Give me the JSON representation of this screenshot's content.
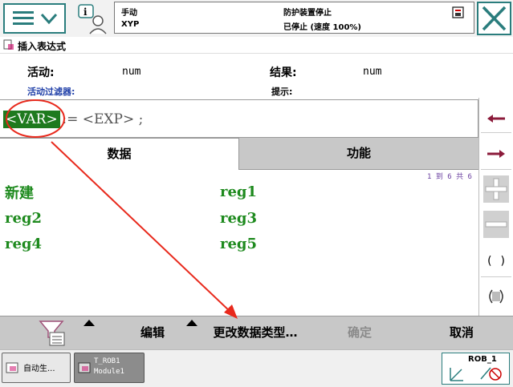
{
  "status": {
    "mode": "手动",
    "controller": "XYP",
    "protection": "防护装置停止",
    "speed": "已停止 (速度 100%)"
  },
  "window_title": "插入表达式",
  "info": {
    "active_label": "活动:",
    "active_value": "num",
    "result_label": "结果:",
    "result_value": "num",
    "filter_label": "活动过滤器:",
    "hint_label": "提示:"
  },
  "expression": {
    "selected_token": "<VAR>",
    "rest": " := <EXP> ;"
  },
  "tabs": {
    "data": "数据",
    "function": "功能"
  },
  "list_count": "1 到 6 共 6",
  "items": [
    "新建",
    "reg1",
    "reg2",
    "reg3",
    "reg4",
    "reg5"
  ],
  "right_buttons": {
    "parens": "( )"
  },
  "toolbar": {
    "edit": "编辑",
    "change_type": "更改数据类型…",
    "ok": "确定",
    "cancel": "取消"
  },
  "taskbar": {
    "task1": "自动生...",
    "task2_line1": "T_ROB1",
    "task2_line2": "Module1",
    "robot": "ROB_1"
  },
  "colors": {
    "accent": "#2a7d7d",
    "item_green": "#1e8a1e",
    "token_bg": "#1e7a1e",
    "annotation_red": "#e8291c",
    "filter_blue": "#1f3fa8"
  }
}
